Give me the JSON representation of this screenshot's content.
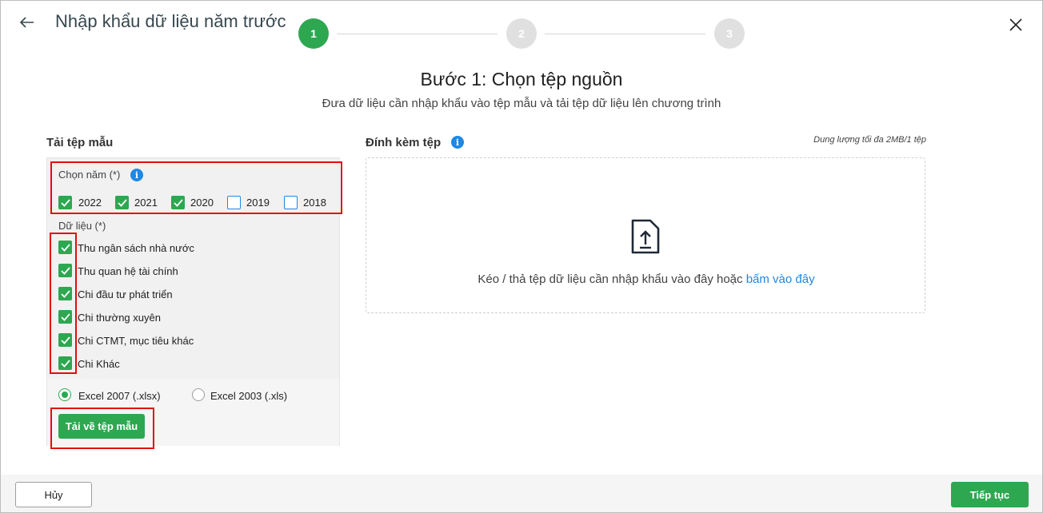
{
  "header": {
    "title": "Nhập khẩu dữ liệu năm trước",
    "back_icon": "arrow-left-icon",
    "close_icon": "close-icon"
  },
  "stepper": {
    "steps": [
      "1",
      "2",
      "3"
    ],
    "active_step": 1,
    "active_color": "#2ea751"
  },
  "step": {
    "title": "Bước 1: Chọn tệp nguồn",
    "subtitle": "Đưa dữ liệu cần nhập khẩu vào tệp mẫu và tải tệp dữ liệu lên chương trình"
  },
  "template": {
    "heading": "Tải tệp mẫu",
    "year_label": "Chọn năm (*)",
    "years": [
      {
        "label": "2022",
        "checked": true
      },
      {
        "label": "2021",
        "checked": true
      },
      {
        "label": "2020",
        "checked": true
      },
      {
        "label": "2019",
        "checked": false
      },
      {
        "label": "2018",
        "checked": false
      }
    ],
    "data_label": "Dữ liệu (*)",
    "data_items": [
      {
        "label": "Thu ngân sách nhà nước",
        "checked": true
      },
      {
        "label": "Thu quan hệ tài chính",
        "checked": true
      },
      {
        "label": "Chi đầu tư phát triển",
        "checked": true
      },
      {
        "label": "Chi thường xuyên",
        "checked": true
      },
      {
        "label": "Chi CTMT, mục tiêu khác",
        "checked": true
      },
      {
        "label": "Chi Khác",
        "checked": true
      }
    ],
    "formats": [
      {
        "label": "Excel 2007 (.xlsx)",
        "selected": true
      },
      {
        "label": "Excel 2003 (.xls)",
        "selected": false
      }
    ],
    "download_label": "Tải về tệp mẫu"
  },
  "attach": {
    "heading": "Đính kèm tệp",
    "size_note": "Dung lượng tối đa 2MB/1 tệp",
    "drop_text": "Kéo / thả tệp dữ liệu cần nhập khẩu vào đây hoặc",
    "drop_link": "bấm vào đây",
    "upload_icon": "file-upload-icon"
  },
  "footer": {
    "cancel_label": "Hủy",
    "next_label": "Tiếp tục"
  },
  "colors": {
    "accent": "#2ea751",
    "link": "#1e88e5",
    "highlight": "#e10e0e"
  }
}
